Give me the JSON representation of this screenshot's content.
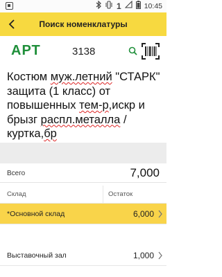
{
  "status_bar": {
    "sim_number": "1",
    "time": "10:45",
    "icons": [
      "bluetooth-icon",
      "vibrate-icon",
      "signal-icon",
      "battery-icon"
    ]
  },
  "header": {
    "title": "Поиск номенклатуры",
    "back_icon": "chevron-left-icon"
  },
  "article": {
    "label": "АРТ",
    "code": "3138",
    "search_icon": "search-icon",
    "barcode_icon": "barcode-scan-icon"
  },
  "item": {
    "name_parts": [
      {
        "text": "Костюм ",
        "spell": false
      },
      {
        "text": "муж.летний",
        "spell": true
      },
      {
        "text": " \"СТАРК\" защита (1 класс) от повышенных ",
        "spell": false
      },
      {
        "text": "тем-р",
        "spell": true
      },
      {
        "text": ",искр и брызг ",
        "spell": false
      },
      {
        "text": "распл.металла",
        "spell": true
      },
      {
        "text": " / куртка,",
        "spell": false
      },
      {
        "text": "бр",
        "spell": true
      }
    ]
  },
  "total": {
    "label": "Всего",
    "value": "7,000"
  },
  "stock_table": {
    "col_warehouse": "Склад",
    "col_balance": "Остаток",
    "rows": [
      {
        "warehouse": "*Основной склад",
        "balance": "6,000",
        "selected": true
      },
      {
        "warehouse": "Выставочный зал",
        "balance": "1,000",
        "selected": false
      }
    ]
  },
  "colors": {
    "accent_yellow": "#f7d940",
    "selected_row": "#f9d44a",
    "article_green": "#1f8f3a"
  }
}
